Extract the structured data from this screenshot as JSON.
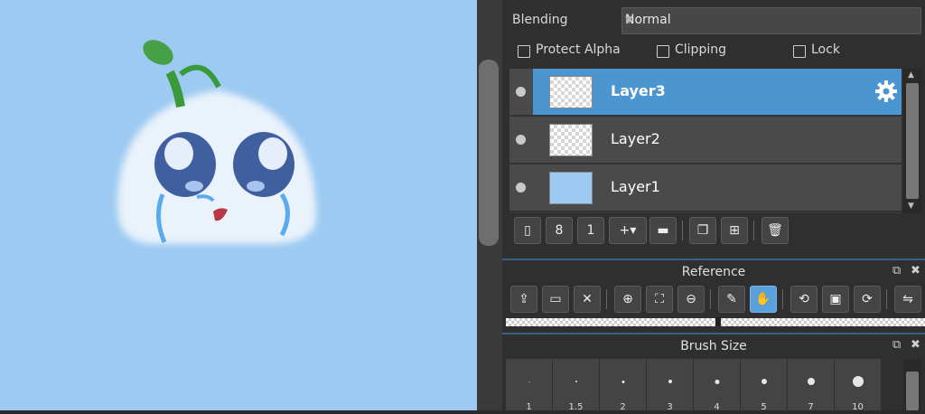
{
  "layer_props": {
    "blending_label": "Blending",
    "blending_value": "Normal",
    "protect_alpha_label": "Protect Alpha",
    "clipping_label": "Clipping",
    "lock_label": "Lock"
  },
  "layers": [
    {
      "name": "Layer3",
      "selected": true
    },
    {
      "name": "Layer2",
      "selected": false
    },
    {
      "name": "Layer1",
      "selected": false
    }
  ],
  "reference": {
    "title": "Reference"
  },
  "brush_size": {
    "title": "Brush Size",
    "sizes": [
      "1",
      "1.5",
      "2",
      "3",
      "4",
      "5",
      "7",
      "10"
    ]
  },
  "colors": {
    "canvas_bg": "#9ccaf2",
    "selection": "#4b96d1",
    "panel_bg": "#2f2f2f"
  }
}
